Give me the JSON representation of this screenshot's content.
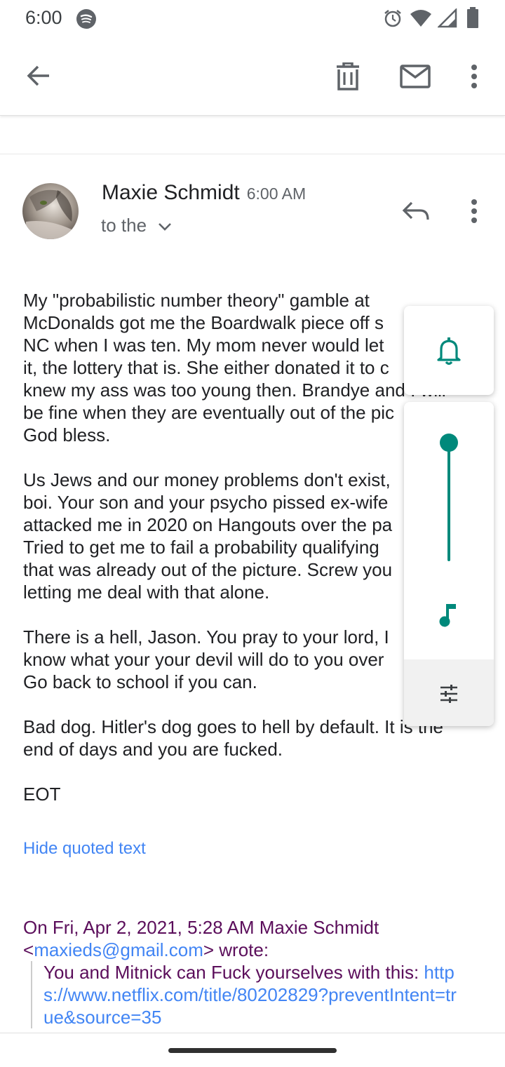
{
  "status_bar": {
    "time": "6:00",
    "icons": [
      "spotify-icon",
      "alarm-icon",
      "wifi-icon",
      "signal-icon",
      "battery-icon"
    ]
  },
  "toolbar": {
    "icons": [
      "back-arrow-icon",
      "delete-icon",
      "mark-unread-icon",
      "more-vert-icon"
    ]
  },
  "email": {
    "sender_name": "Maxie Schmidt",
    "time": "6:00 AM",
    "recipient": "to the",
    "paragraphs": [
      "My \"probabilistic number theory\" gamble at\nMcDonalds got me the Boardwalk piece off s\nNC when I was ten. My mom never would let\nit, the lottery that is. She either donated it to c\nknew my ass was too young then. Brandye and I will\nbe fine when they are eventually out of the pic\nGod bless.",
      "Us Jews and our money problems don't exist,\nboi. Your son and your psycho pissed ex-wife\nattacked me in 2020 on Hangouts over the pa\nTried to get me to fail a probability qualifying\nthat was already out of the picture. Screw you\nletting me deal with that alone.",
      "There is a hell, Jason. You pray to your lord, I\nknow what your your devil will do to you over\nGo back to school if you can.",
      "Bad dog. Hitler's dog goes to hell by default. It is the\nend of days and you are fucked.",
      "EOT"
    ],
    "hide_quoted_label": "Hide quoted text",
    "quote_header_prefix": "On Fri, Apr 2, 2021, 5:28 AM Maxie Schmidt",
    "quote_header_lt": "<",
    "quote_email": "maxieds@gmail.com",
    "quote_header_suffix": "> wrote:",
    "quote_text": "You and Mitnick can Fuck yourselves with this: ",
    "quote_link": "https://www.netflix.com/title/80202829?preventIntent=true&source=35"
  },
  "volume_panel": {
    "accent_color": "#00897b",
    "level": 1.0,
    "icons": [
      "bell-icon",
      "music-note-icon",
      "tune-icon"
    ]
  },
  "colors": {
    "link": "#4285f4",
    "quote_text": "#5b0e5b",
    "accent": "#00897b"
  }
}
